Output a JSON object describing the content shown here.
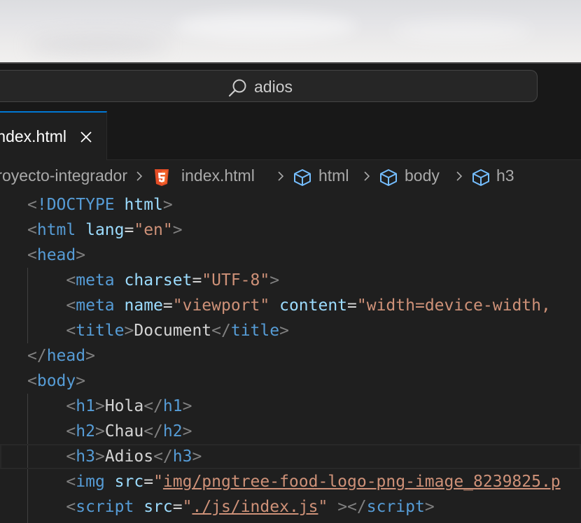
{
  "search": {
    "query": "adios"
  },
  "tab": {
    "label": "index.html"
  },
  "breadcrumb": {
    "folder": "proyecto-integrador",
    "file": "index.html",
    "symbols": [
      "html",
      "body",
      "h3"
    ]
  },
  "code_lines": [
    [
      [
        "cm",
        "<"
      ],
      [
        "tg",
        "!DOCTYPE"
      ],
      [
        "tx",
        " "
      ],
      [
        "at",
        "html"
      ],
      [
        "cm",
        ">"
      ]
    ],
    [
      [
        "cm",
        "<"
      ],
      [
        "tg",
        "html"
      ],
      [
        "tx",
        " "
      ],
      [
        "at",
        "lang"
      ],
      [
        "tx",
        "="
      ],
      [
        "vl",
        "\"en\""
      ],
      [
        "cm",
        ">"
      ]
    ],
    [
      [
        "cm",
        "<"
      ],
      [
        "tg",
        "head"
      ],
      [
        "cm",
        ">"
      ]
    ],
    [
      [
        "tx",
        "    "
      ],
      [
        "cm",
        "<"
      ],
      [
        "tg",
        "meta"
      ],
      [
        "tx",
        " "
      ],
      [
        "at",
        "charset"
      ],
      [
        "tx",
        "="
      ],
      [
        "vl",
        "\"UTF-8\""
      ],
      [
        "cm",
        ">"
      ]
    ],
    [
      [
        "tx",
        "    "
      ],
      [
        "cm",
        "<"
      ],
      [
        "tg",
        "meta"
      ],
      [
        "tx",
        " "
      ],
      [
        "at",
        "name"
      ],
      [
        "tx",
        "="
      ],
      [
        "vl",
        "\"viewport\""
      ],
      [
        "tx",
        " "
      ],
      [
        "at",
        "content"
      ],
      [
        "tx",
        "="
      ],
      [
        "vl",
        "\"width=device-width,"
      ]
    ],
    [
      [
        "tx",
        "    "
      ],
      [
        "cm",
        "<"
      ],
      [
        "tg",
        "title"
      ],
      [
        "cm",
        ">"
      ],
      [
        "tx",
        "Document"
      ],
      [
        "cm",
        "</"
      ],
      [
        "tg",
        "title"
      ],
      [
        "cm",
        ">"
      ]
    ],
    [
      [
        "cm",
        "</"
      ],
      [
        "tg",
        "head"
      ],
      [
        "cm",
        ">"
      ]
    ],
    [
      [
        "cm",
        "<"
      ],
      [
        "tg",
        "body"
      ],
      [
        "cm",
        ">"
      ]
    ],
    [
      [
        "tx",
        "    "
      ],
      [
        "cm",
        "<"
      ],
      [
        "tg",
        "h1"
      ],
      [
        "cm",
        ">"
      ],
      [
        "tx",
        "Hola"
      ],
      [
        "cm",
        "</"
      ],
      [
        "tg",
        "h1"
      ],
      [
        "cm",
        ">"
      ]
    ],
    [
      [
        "tx",
        "    "
      ],
      [
        "cm",
        "<"
      ],
      [
        "tg",
        "h2"
      ],
      [
        "cm",
        ">"
      ],
      [
        "tx",
        "Chau"
      ],
      [
        "cm",
        "</"
      ],
      [
        "tg",
        "h2"
      ],
      [
        "cm",
        ">"
      ]
    ],
    [
      [
        "tx",
        "    "
      ],
      [
        "cm",
        "<"
      ],
      [
        "tg",
        "h3"
      ],
      [
        "cm",
        ">"
      ],
      [
        "tx",
        "Adios"
      ],
      [
        "cm",
        "</"
      ],
      [
        "tg",
        "h3"
      ],
      [
        "cm",
        ">"
      ]
    ],
    [
      [
        "tx",
        "    "
      ],
      [
        "cm",
        "<"
      ],
      [
        "tg",
        "img"
      ],
      [
        "tx",
        " "
      ],
      [
        "at",
        "src"
      ],
      [
        "tx",
        "="
      ],
      [
        "vl",
        "\""
      ],
      [
        "vl ul",
        "img/pngtree-food-logo-png-image_8239825.p"
      ]
    ],
    [
      [
        "tx",
        "    "
      ],
      [
        "cm",
        "<"
      ],
      [
        "tg",
        "script"
      ],
      [
        "tx",
        " "
      ],
      [
        "at",
        "src"
      ],
      [
        "tx",
        "="
      ],
      [
        "vl",
        "\""
      ],
      [
        "vl ul",
        "./js/index.js"
      ],
      [
        "vl",
        "\""
      ],
      [
        "tx",
        " "
      ],
      [
        "cm",
        "></"
      ],
      [
        "tg",
        "script"
      ],
      [
        "cm",
        ">"
      ]
    ]
  ],
  "current_line": 10,
  "colors": {
    "editor_bg": "#1f1f1f",
    "tag": "#569cd6",
    "attribute": "#9cdcfe",
    "string": "#ce9178",
    "punctuation": "#808080",
    "text": "#d4d4d4",
    "html_icon": "#e44d26",
    "symbol_icon": "#75beff",
    "tab_accent": "#0078d4"
  }
}
